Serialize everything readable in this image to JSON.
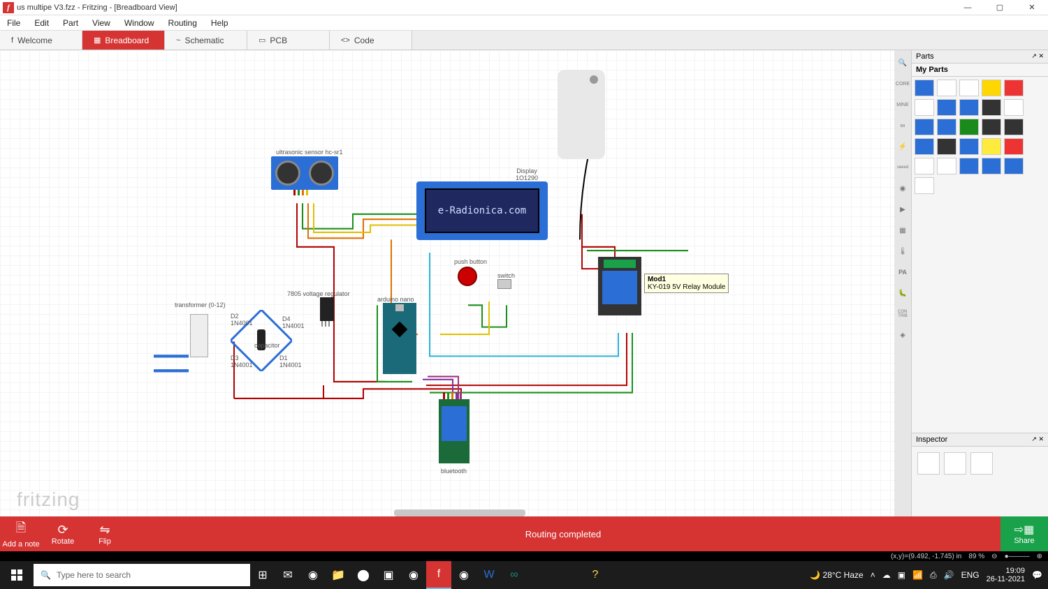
{
  "title": "us multipe V3.fzz - Fritzing - [Breadboard View]",
  "menu": {
    "file": "File",
    "edit": "Edit",
    "part": "Part",
    "view": "View",
    "window": "Window",
    "routing": "Routing",
    "help": "Help"
  },
  "tabs": {
    "welcome": "Welcome",
    "breadboard": "Breadboard",
    "schematic": "Schematic",
    "pcb": "PCB",
    "code": "Code"
  },
  "labels": {
    "ultrasonic": "ultrasonic sensor hc-sr1",
    "display": "Display\n1O1290",
    "display_text": "e-Radionica.com",
    "arduino": "arduino nano",
    "regulator": "7805 voltage regulator",
    "transformer": "transformer (0-12)",
    "pushbutton": "push button",
    "switch": "switch",
    "bluetooth": "bluetooth",
    "capacitor": "capacitor",
    "d1": "D1\n1N4001",
    "d2": "D2\n1N4001",
    "d3": "D3\n1N4001",
    "d4": "D4\n1N4001",
    "relay_name": "Mod1",
    "relay_desc": "KY-019 5V Relay Module"
  },
  "sideTabs": [
    "CORE",
    "MINE",
    "",
    "",
    "seeed",
    "",
    "",
    "",
    "",
    "",
    "CON\nTRIB",
    ""
  ],
  "parts_panel": {
    "title": "Parts",
    "subtitle": "My Parts"
  },
  "inspector_title": "Inspector",
  "footer": {
    "note": "Add a note",
    "rotate": "Rotate",
    "flip": "Flip",
    "routing": "Routing completed",
    "share": "Share"
  },
  "status": {
    "coords": "(x,y)=(9.492, -1.745) in",
    "zoom": "89 %"
  },
  "taskbar": {
    "search_placeholder": "Type here to search",
    "weather": "28°C Haze",
    "lang": "ENG",
    "time": "19:09",
    "date": "26-11-2021"
  },
  "watermark": "fritzing"
}
